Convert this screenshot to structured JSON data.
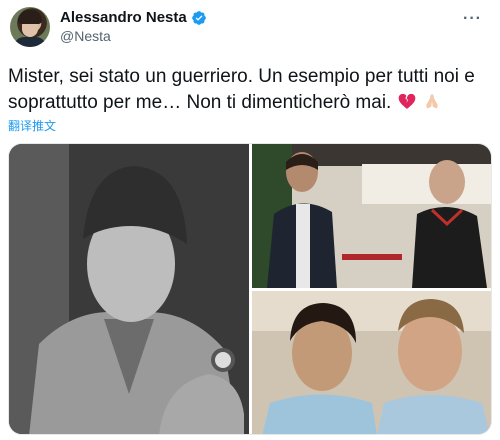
{
  "author": {
    "display_name": "Alessandro Nesta",
    "handle": "@Nesta",
    "verified": true,
    "avatar_icon": "avatar"
  },
  "header": {
    "more_label": "···"
  },
  "tweet": {
    "text": "Mister, sei stato un guerriero. Un esempio per tutti noi e soprattutto per me… Non ti dimenticherò mai.",
    "emojis": [
      "broken-heart-icon",
      "folded-hands-icon"
    ],
    "translate_label": "翻译推文"
  },
  "media": {
    "images": [
      "main-portrait-photo",
      "two-men-talking-photo",
      "two-players-photo"
    ]
  },
  "colors": {
    "accent": "#1d9bf0",
    "secondary_text": "#536471",
    "primary_text": "#0f1419",
    "verified_badge": "#1d9bf0",
    "broken_heart": "#e0245e"
  }
}
